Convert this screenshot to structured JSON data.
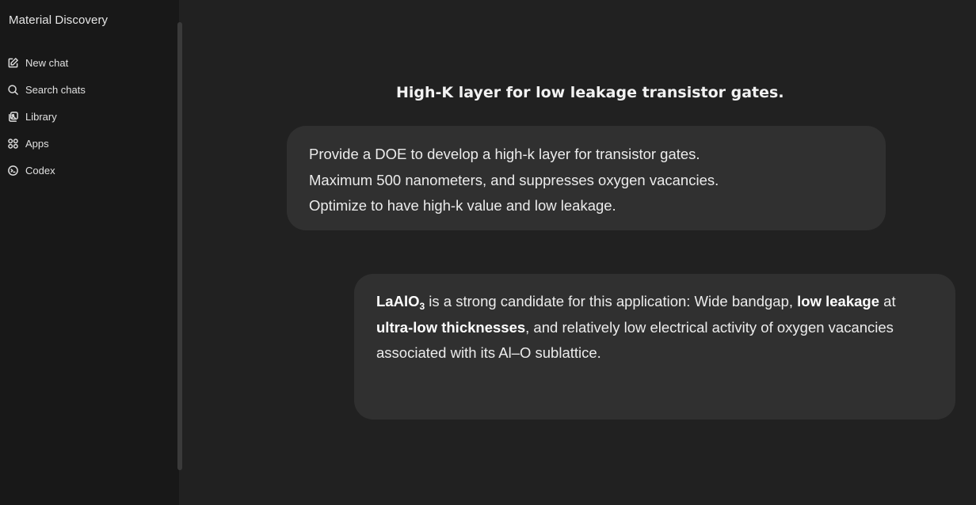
{
  "sidebar": {
    "title": "Material Discovery",
    "items": [
      {
        "label": "New chat",
        "icon": "edit-icon"
      },
      {
        "label": "Search chats",
        "icon": "search-icon"
      },
      {
        "label": "Library",
        "icon": "library-icon"
      },
      {
        "label": "Apps",
        "icon": "apps-icon"
      },
      {
        "label": "Codex",
        "icon": "codex-icon"
      }
    ]
  },
  "chat": {
    "title": "High-K layer for low leakage transistor gates.",
    "user_message": {
      "lines": [
        "Provide a DOE to develop a high-k layer for transistor gates.",
        "Maximum 500 nanometers, and suppresses oxygen vacancies.",
        "Optimize to have high-k value and low leakage."
      ]
    },
    "assistant_message": {
      "compound_base": "LaAlO",
      "compound_sub": "3",
      "text_1": " is a strong candidate for this application: Wide bandgap, ",
      "bold_1": "low leakage",
      "text_2": " at ",
      "bold_2": "ultra-low thicknesses",
      "text_3": ", and relatively low electrical activity of oxygen vacancies associated with its Al–O sublattice."
    }
  },
  "colors": {
    "sidebar_bg": "#181818",
    "main_bg": "#212121",
    "bubble_bg": "#303030",
    "text": "#ececec"
  }
}
